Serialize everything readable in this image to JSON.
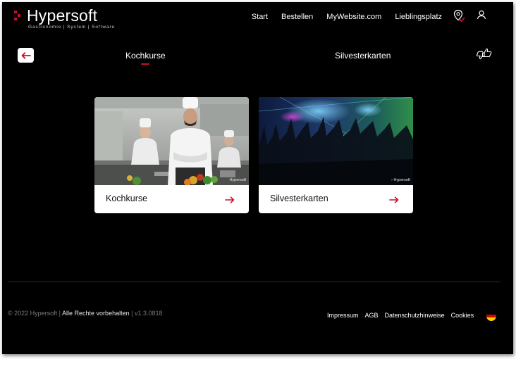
{
  "brand": {
    "name": "Hypersoft",
    "tagline": "Gastronomie | System | Software",
    "accent_color": "#c8102e"
  },
  "nav": {
    "items": [
      "Start",
      "Bestellen",
      "MyWebsite.com",
      "Lieblingsplatz"
    ],
    "icons": [
      "location-pin-check-icon",
      "user-icon"
    ]
  },
  "categories": {
    "back_icon": "arrow-left-icon",
    "tabs": [
      {
        "label": "Kochkurse",
        "active": true
      },
      {
        "label": "Silvesterkarten",
        "active": false
      }
    ],
    "feedback_icon": "thumbs-up-down-icon"
  },
  "cards": [
    {
      "title": "Kochkurse",
      "image": "chef-kitchen-photo",
      "watermark": "Hypersoft",
      "arrow_icon": "arrow-right-icon"
    },
    {
      "title": "Silvesterkarten",
      "image": "party-crowd-photo",
      "watermark": "› Hypersoft",
      "arrow_icon": "arrow-right-icon"
    }
  ],
  "footer": {
    "copyright": "© 2022 Hypersoft |",
    "rights": "Alle Rechte vorbehalten",
    "version": "| v1.3.0818",
    "links": [
      "Impressum",
      "AGB",
      "Datenschutzhinweise",
      "Cookies"
    ],
    "language_flag": "german-flag"
  }
}
